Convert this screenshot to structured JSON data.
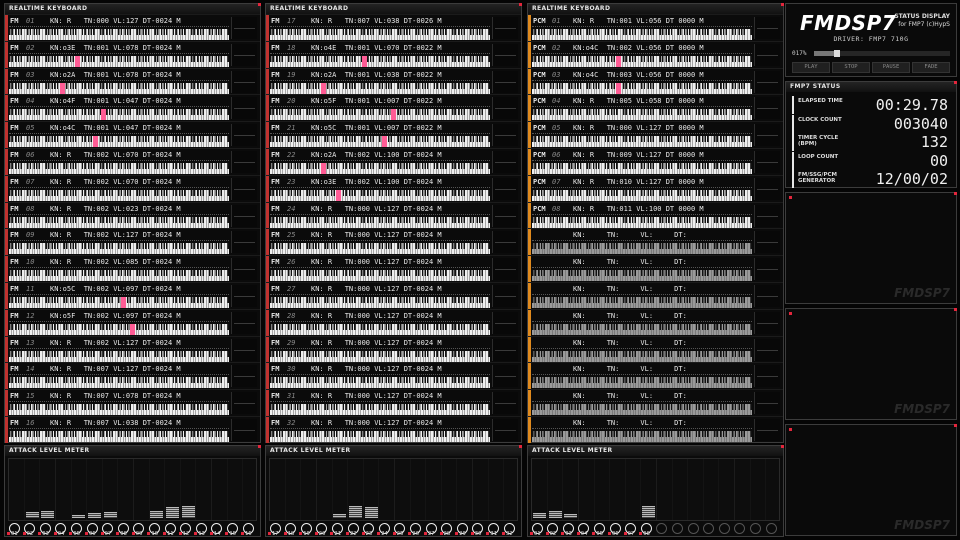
{
  "keyboard_title": "REALTIME KEYBOARD",
  "meter_title": "ATTACK LEVEL METER",
  "columns": [
    {
      "indicator": "#c0322f",
      "channels": [
        {
          "type": "FM",
          "num": "01",
          "vals": "KN: R   TN:000 VL:127 DT-0024 M",
          "notes": []
        },
        {
          "type": "FM",
          "num": "02",
          "vals": "KN:o3E  TN:001 VL:078 DT-0024 M",
          "notes": [
            0.3
          ]
        },
        {
          "type": "FM",
          "num": "03",
          "vals": "KN:o2A  TN:001 VL:078 DT-0024 M",
          "notes": [
            0.23
          ]
        },
        {
          "type": "FM",
          "num": "04",
          "vals": "KN:o4F  TN:001 VL:047 DT-0024 M",
          "notes": [
            0.42
          ]
        },
        {
          "type": "FM",
          "num": "05",
          "vals": "KN:o4C  TN:001 VL:047 DT-0024 M",
          "notes": [
            0.38
          ]
        },
        {
          "type": "FM",
          "num": "06",
          "vals": "KN: R   TN:002 VL:070 DT-0024 M",
          "notes": []
        },
        {
          "type": "FM",
          "num": "07",
          "vals": "KN: R   TN:002 VL:070 DT-0024 M",
          "notes": []
        },
        {
          "type": "FM",
          "num": "08",
          "vals": "KN: R   TN:002 VL:023 DT-0024 M",
          "notes": []
        },
        {
          "type": "FM",
          "num": "09",
          "vals": "KN: R   TN:002 VL:127 DT-0024 M",
          "notes": []
        },
        {
          "type": "FM",
          "num": "10",
          "vals": "KN: R   TN:002 VL:085 DT-0024 M",
          "notes": []
        },
        {
          "type": "FM",
          "num": "11",
          "vals": "KN:o5C  TN:002 VL:097 DT-0024 M",
          "notes": [
            0.51
          ]
        },
        {
          "type": "FM",
          "num": "12",
          "vals": "KN:o5F  TN:002 VL:097 DT-0024 M",
          "notes": [
            0.55
          ]
        },
        {
          "type": "FM",
          "num": "13",
          "vals": "KN: R   TN:002 VL:127 DT-0024 M",
          "notes": []
        },
        {
          "type": "FM",
          "num": "14",
          "vals": "KN: R   TN:007 VL:127 DT-0024 M",
          "notes": []
        },
        {
          "type": "FM",
          "num": "15",
          "vals": "KN: R   TN:007 VL:078 DT-0024 M",
          "notes": []
        },
        {
          "type": "FM",
          "num": "16",
          "vals": "KN: R   TN:007 VL:038 DT-0024 M",
          "notes": []
        }
      ]
    },
    {
      "indicator": "#c0322f",
      "channels": [
        {
          "type": "FM",
          "num": "17",
          "vals": "KN: R   TN:007 VL:038 DT-0026 M",
          "notes": []
        },
        {
          "type": "FM",
          "num": "18",
          "vals": "KN:o4E  TN:001 VL:070 DT-0022 M",
          "notes": [
            0.42
          ]
        },
        {
          "type": "FM",
          "num": "19",
          "vals": "KN:o2A  TN:001 VL:038 DT-0022 M",
          "notes": [
            0.23
          ]
        },
        {
          "type": "FM",
          "num": "20",
          "vals": "KN:o5F  TN:001 VL:007 DT-0022 M",
          "notes": [
            0.55
          ]
        },
        {
          "type": "FM",
          "num": "21",
          "vals": "KN:o5C  TN:001 VL:007 DT-0022 M",
          "notes": [
            0.51
          ]
        },
        {
          "type": "FM",
          "num": "22",
          "vals": "KN:o2A  TN:002 VL:100 DT-0024 M",
          "notes": [
            0.23
          ]
        },
        {
          "type": "FM",
          "num": "23",
          "vals": "KN:o3E  TN:002 VL:100 DT-0024 M",
          "notes": [
            0.3
          ]
        },
        {
          "type": "FM",
          "num": "24",
          "vals": "KN: R   TN:000 VL:127 DT-0024 M",
          "notes": []
        },
        {
          "type": "FM",
          "num": "25",
          "vals": "KN: R   TN:000 VL:127 DT-0024 M",
          "notes": []
        },
        {
          "type": "FM",
          "num": "26",
          "vals": "KN: R   TN:000 VL:127 DT-0024 M",
          "notes": []
        },
        {
          "type": "FM",
          "num": "27",
          "vals": "KN: R   TN:000 VL:127 DT-0024 M",
          "notes": []
        },
        {
          "type": "FM",
          "num": "28",
          "vals": "KN: R   TN:000 VL:127 DT-0024 M",
          "notes": []
        },
        {
          "type": "FM",
          "num": "29",
          "vals": "KN: R   TN:000 VL:127 DT-0024 M",
          "notes": []
        },
        {
          "type": "FM",
          "num": "30",
          "vals": "KN: R   TN:000 VL:127 DT-0024 M",
          "notes": []
        },
        {
          "type": "FM",
          "num": "31",
          "vals": "KN: R   TN:000 VL:127 DT-0024 M",
          "notes": []
        },
        {
          "type": "FM",
          "num": "32",
          "vals": "KN: R   TN:000 VL:127 DT-0024 M",
          "notes": []
        }
      ]
    },
    {
      "indicator": "#e08a1e",
      "channels": [
        {
          "type": "PCM",
          "num": "01",
          "vals": "KN: R   TN:001 VL:056 DT 0000 M",
          "notes": []
        },
        {
          "type": "PCM",
          "num": "02",
          "vals": "KN:o4C  TN:002 VL:056 DT 0000 M",
          "notes": [
            0.38
          ]
        },
        {
          "type": "PCM",
          "num": "03",
          "vals": "KN:o4C  TN:003 VL:056 DT 0000 M",
          "notes": [
            0.38
          ]
        },
        {
          "type": "PCM",
          "num": "04",
          "vals": "KN: R   TN:005 VL:058 DT 0000 M",
          "notes": []
        },
        {
          "type": "PCM",
          "num": "05",
          "vals": "KN: R   TN:000 VL:127 DT 0000 M",
          "notes": []
        },
        {
          "type": "PCM",
          "num": "06",
          "vals": "KN: R   TN:009 VL:127 DT 0000 M",
          "notes": []
        },
        {
          "type": "PCM",
          "num": "07",
          "vals": "KN: R   TN:010 VL:127 DT 0000 M",
          "notes": []
        },
        {
          "type": "PCM",
          "num": "08",
          "vals": "KN: R   TN:011 VL:100 DT 0000 M",
          "notes": []
        },
        {
          "type": "",
          "num": "",
          "vals": "KN:     TN:     VL:     DT:      ",
          "notes": [],
          "off": true
        },
        {
          "type": "",
          "num": "",
          "vals": "KN:     TN:     VL:     DT:      ",
          "notes": [],
          "off": true
        },
        {
          "type": "",
          "num": "",
          "vals": "KN:     TN:     VL:     DT:      ",
          "notes": [],
          "off": true
        },
        {
          "type": "",
          "num": "",
          "vals": "KN:     TN:     VL:     DT:      ",
          "notes": [],
          "off": true
        },
        {
          "type": "",
          "num": "",
          "vals": "KN:     TN:     VL:     DT:      ",
          "notes": [],
          "off": true
        },
        {
          "type": "",
          "num": "",
          "vals": "KN:     TN:     VL:     DT:      ",
          "notes": [],
          "off": true
        },
        {
          "type": "",
          "num": "",
          "vals": "KN:     TN:     VL:     DT:      ",
          "notes": [],
          "off": true
        },
        {
          "type": "",
          "num": "",
          "vals": "KN:     TN:     VL:     DT:      ",
          "notes": [],
          "off": true
        }
      ]
    }
  ],
  "meters": [
    {
      "labels": [
        "01",
        "02",
        "03",
        "04",
        "05",
        "06",
        "07",
        "08",
        "09",
        "10",
        "11",
        "12",
        "13",
        "14",
        "15",
        "16"
      ],
      "levels": [
        0,
        0.1,
        0.12,
        0,
        0.05,
        0.08,
        0.1,
        0,
        0,
        0.12,
        0.18,
        0.2,
        0,
        0,
        0,
        0
      ]
    },
    {
      "labels": [
        "17",
        "18",
        "19",
        "20",
        "21",
        "22",
        "23",
        "24",
        "25",
        "26",
        "27",
        "28",
        "29",
        "30",
        "31",
        "32"
      ],
      "levels": [
        0,
        0,
        0,
        0,
        0.06,
        0.2,
        0.18,
        0,
        0,
        0,
        0,
        0,
        0,
        0,
        0,
        0
      ]
    },
    {
      "labels": [
        "01",
        "02",
        "03",
        "04",
        "05",
        "06",
        "07",
        "08",
        "",
        "",
        "",
        "",
        "",
        "",
        "",
        ""
      ],
      "levels": [
        0.08,
        0.12,
        0.06,
        0,
        0,
        0,
        0,
        0.2,
        0,
        0,
        0,
        0,
        0,
        0,
        0,
        0
      ]
    }
  ],
  "logo": {
    "title": "FMDSP7",
    "sub1": "STATUS DISPLAY",
    "sub2": "for FMP7 (c)HypS",
    "driver": "DRIVER: FMP7  710G"
  },
  "progress": {
    "label": "017%",
    "value": 0.17
  },
  "buttons": [
    "PLAY",
    "STOP",
    "PAUSE",
    "FADE"
  ],
  "status": {
    "title": "FMP7 STATUS",
    "rows": [
      {
        "key": "ELAPSED TIME",
        "value": "00:29.78"
      },
      {
        "key": "CLOCK COUNT",
        "value": "003040"
      },
      {
        "key": "TIMER CYCLE (BPM)",
        "value": "132"
      },
      {
        "key": "LOOP COUNT",
        "value": "00"
      },
      {
        "key": "FM/SSG/PCM GENERATOR",
        "value": "12/00/02"
      }
    ]
  },
  "watermark": "FMDSP7"
}
